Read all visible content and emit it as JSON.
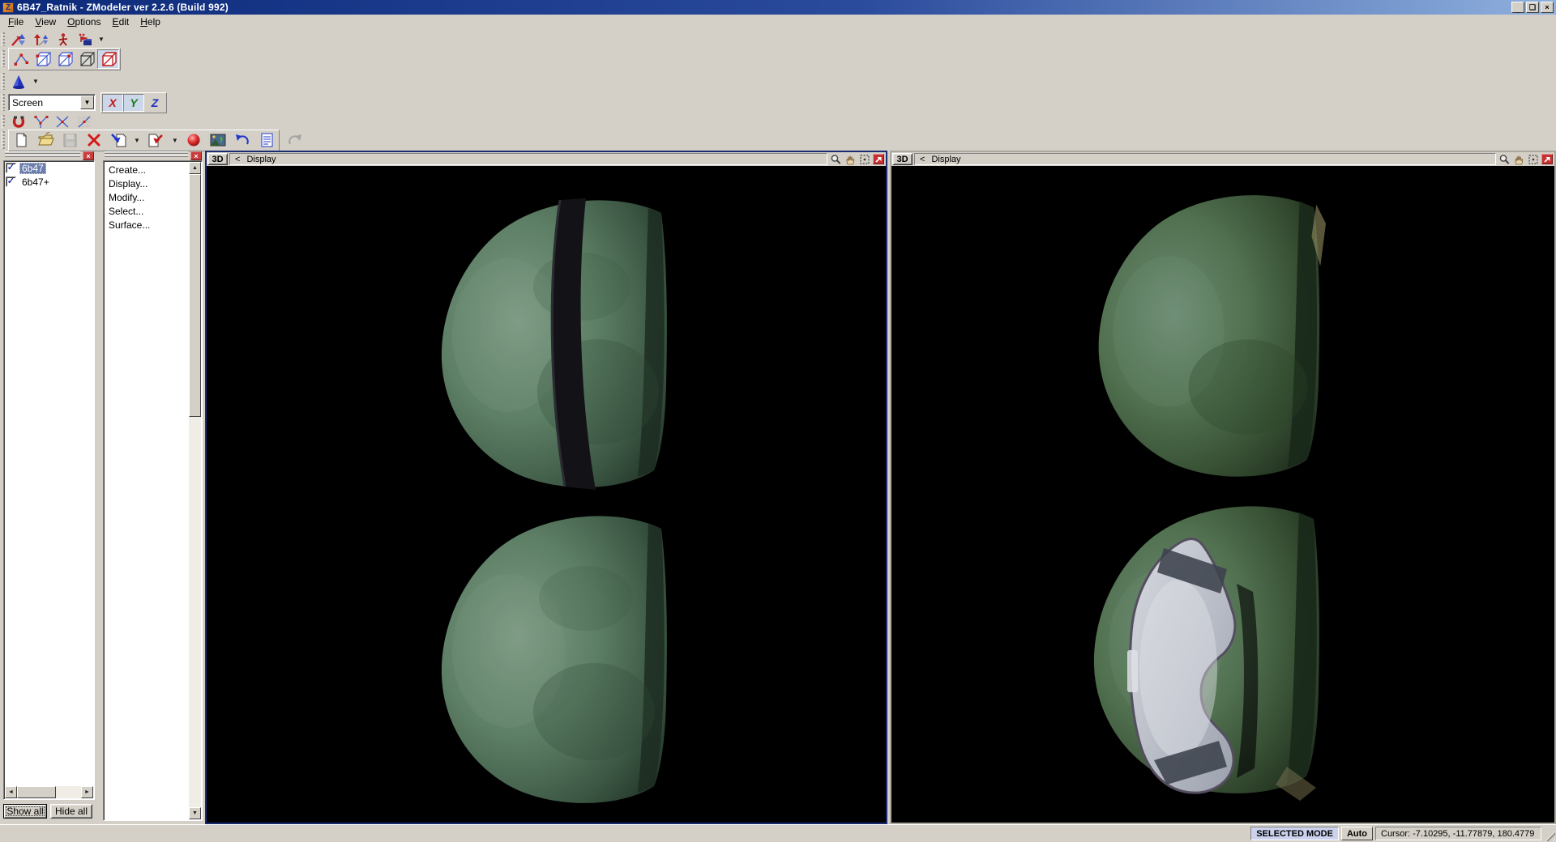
{
  "window": {
    "title": "6B47_Ratnik - ZModeler ver 2.2.6 (Build 992)",
    "app_icon_letter": "Z"
  },
  "menu_bar": {
    "items": [
      "File",
      "View",
      "Options",
      "Edit",
      "Help"
    ]
  },
  "icons": {
    "minimize": "_",
    "restore": "❏",
    "close": "×",
    "dropdown": "▼",
    "check": "✓",
    "scroll_up": "▲",
    "scroll_down": "▼",
    "scroll_left": "◄",
    "scroll_right": "►",
    "toolbar_icon_names": [
      "scale-tool-icon",
      "pin-tool-icon",
      "figure-tool-icon",
      "flag-settings-icon",
      "vertices-level-icon",
      "edges-level-icon",
      "polygons-level-icon",
      "mesh-level-icon",
      "objects-level-icon",
      "cone-icon",
      "magnet-icon",
      "weld-vertices-icon",
      "break-vertices-icon",
      "snap-grid-icon",
      "new-file-icon",
      "open-file-icon",
      "save-icon",
      "delete-icon",
      "import-icon",
      "export-icon",
      "material-sphere-icon",
      "texture-icon",
      "undo-icon",
      "script-icon",
      "redo-icon",
      "zoom-icon",
      "pan-hand-icon",
      "orbit-icon",
      "maximize-viewport-icon"
    ]
  },
  "toolbars": {
    "axis_row": {
      "combo_value": "Screen",
      "buttons": [
        {
          "label": "X",
          "pressed": true
        },
        {
          "label": "Y",
          "pressed": true
        },
        {
          "label": "Z",
          "pressed": false
        }
      ]
    },
    "level_row": {
      "active": "objects-level"
    },
    "file_row": {
      "disabled": [
        "save",
        "redo"
      ]
    }
  },
  "scene_panel": {
    "items": [
      {
        "label": "6b47",
        "checked": true,
        "selected": true
      },
      {
        "label": "6b47+",
        "checked": true,
        "selected": false
      }
    ],
    "buttons": {
      "show_all": "Show all",
      "hide_all": "Hide all"
    }
  },
  "command_panel": {
    "items": [
      "Create...",
      "Display...",
      "Modify...",
      "Select...",
      "Surface..."
    ]
  },
  "viewports": {
    "left": {
      "mode_button": "3D",
      "nav_arrow": "<",
      "label": "Display",
      "active": true
    },
    "right": {
      "mode_button": "3D",
      "nav_arrow": "<",
      "label": "Display",
      "active": false
    }
  },
  "status_bar": {
    "mode": "SELECTED MODE",
    "auto": "Auto",
    "cursor": "Cursor: -7.10295, -11.77879, 180.4779"
  },
  "colors": {
    "titlebar_blue": "#0d2a7a",
    "chrome_gray": "#d4d0c8",
    "viewport_bg": "#000000",
    "active_viewport_border": "#1b2b70",
    "selection_bg": "#6b7dac",
    "toggle_bg": "#ccd7ea",
    "selected_mode_bg": "#ccd2ee",
    "helmet_green": "#5d7f65",
    "helmet_dark_green": "#2c4132",
    "strap_black": "#141418",
    "goggles_gray": "#c0c4cc",
    "red_accent": "#c41818"
  }
}
